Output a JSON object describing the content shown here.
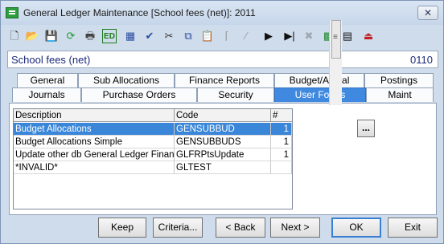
{
  "window": {
    "title": "General Ledger Maintenance  [School fees (net)]: 2011",
    "close_glyph": "✕"
  },
  "toolbar": {
    "icons": [
      {
        "name": "new-document-icon",
        "glyph": "🗋",
        "color": "#333333"
      },
      {
        "name": "open-folder-icon",
        "glyph": "📂",
        "color": "#d8a020"
      },
      {
        "name": "save-icon",
        "glyph": "💾",
        "color": "#9aa4b0"
      },
      {
        "name": "refresh-icon",
        "glyph": "⟳",
        "color": "#1e9a2e"
      },
      {
        "name": "print-icon",
        "glyph": "🖶",
        "color": "#444444"
      },
      {
        "name": "edit-icon",
        "glyph": "ED",
        "color": "#1a7a1a"
      },
      {
        "name": "calculator-icon",
        "glyph": "▦",
        "color": "#2a4aa0"
      },
      {
        "name": "spellcheck-icon",
        "glyph": "✔",
        "color": "#2a4aa0"
      },
      {
        "name": "cut-icon",
        "glyph": "✂",
        "color": "#333333"
      },
      {
        "name": "copy-icon",
        "glyph": "⧉",
        "color": "#2a4aa0"
      },
      {
        "name": "paste-icon",
        "glyph": "📋",
        "color": "#b88a20"
      },
      {
        "name": "first-record-icon",
        "glyph": "⌈",
        "color": "#9a9a9a"
      },
      {
        "name": "previous-record-icon",
        "glyph": "⁄",
        "color": "#9a9a9a"
      },
      {
        "name": "next-record-icon",
        "glyph": "▶",
        "color": "#111111"
      },
      {
        "name": "last-record-icon",
        "glyph": "▶|",
        "color": "#111111"
      },
      {
        "name": "delete-icon",
        "glyph": "✖",
        "color": "#a0a8b0"
      },
      {
        "name": "tree-view-icon",
        "glyph": "▩",
        "color": "#1e8a2e"
      },
      {
        "name": "film-icon",
        "glyph": "▤",
        "color": "#111111"
      },
      {
        "name": "save-exit-icon",
        "glyph": "⏏",
        "color": "#c02020"
      }
    ]
  },
  "record": {
    "name": "School fees (net)",
    "code": "0110"
  },
  "tabs": {
    "row1": [
      {
        "label": "General",
        "name": "tab-general"
      },
      {
        "label": "Sub Allocations",
        "name": "tab-sub-allocations"
      },
      {
        "label": "Finance Reports",
        "name": "tab-finance-reports"
      },
      {
        "label": "Budget/Actual",
        "name": "tab-budget-actual"
      },
      {
        "label": "Postings",
        "name": "tab-postings"
      }
    ],
    "row2": [
      {
        "label": "Journals",
        "name": "tab-journals"
      },
      {
        "label": "Purchase Orders",
        "name": "tab-purchase-orders"
      },
      {
        "label": "Security",
        "name": "tab-security"
      },
      {
        "label": "User Forms",
        "name": "tab-user-forms"
      },
      {
        "label": "Maint",
        "name": "tab-maint"
      }
    ],
    "active": "User Forms"
  },
  "grid": {
    "columns": [
      "Description",
      "Code",
      "#"
    ],
    "rows": [
      {
        "description": "Budget Allocations",
        "code": "GENSUBBUD",
        "num": "1",
        "selected": true
      },
      {
        "description": "Budget Allocations Simple",
        "code": "GENSUBBUDS",
        "num": "1",
        "selected": false
      },
      {
        "description": "Update other db General Ledger Finance",
        "code": "GLFRPtsUpdate",
        "num": "1",
        "selected": false
      },
      {
        "description": "*INVALID*",
        "code": "GLTEST",
        "num": "",
        "selected": false
      }
    ]
  },
  "side_button": "...",
  "buttons": {
    "keep": "Keep",
    "criteria": "Criteria...",
    "back": "< Back",
    "next": "Next >",
    "ok": "OK",
    "exit": "Exit"
  }
}
